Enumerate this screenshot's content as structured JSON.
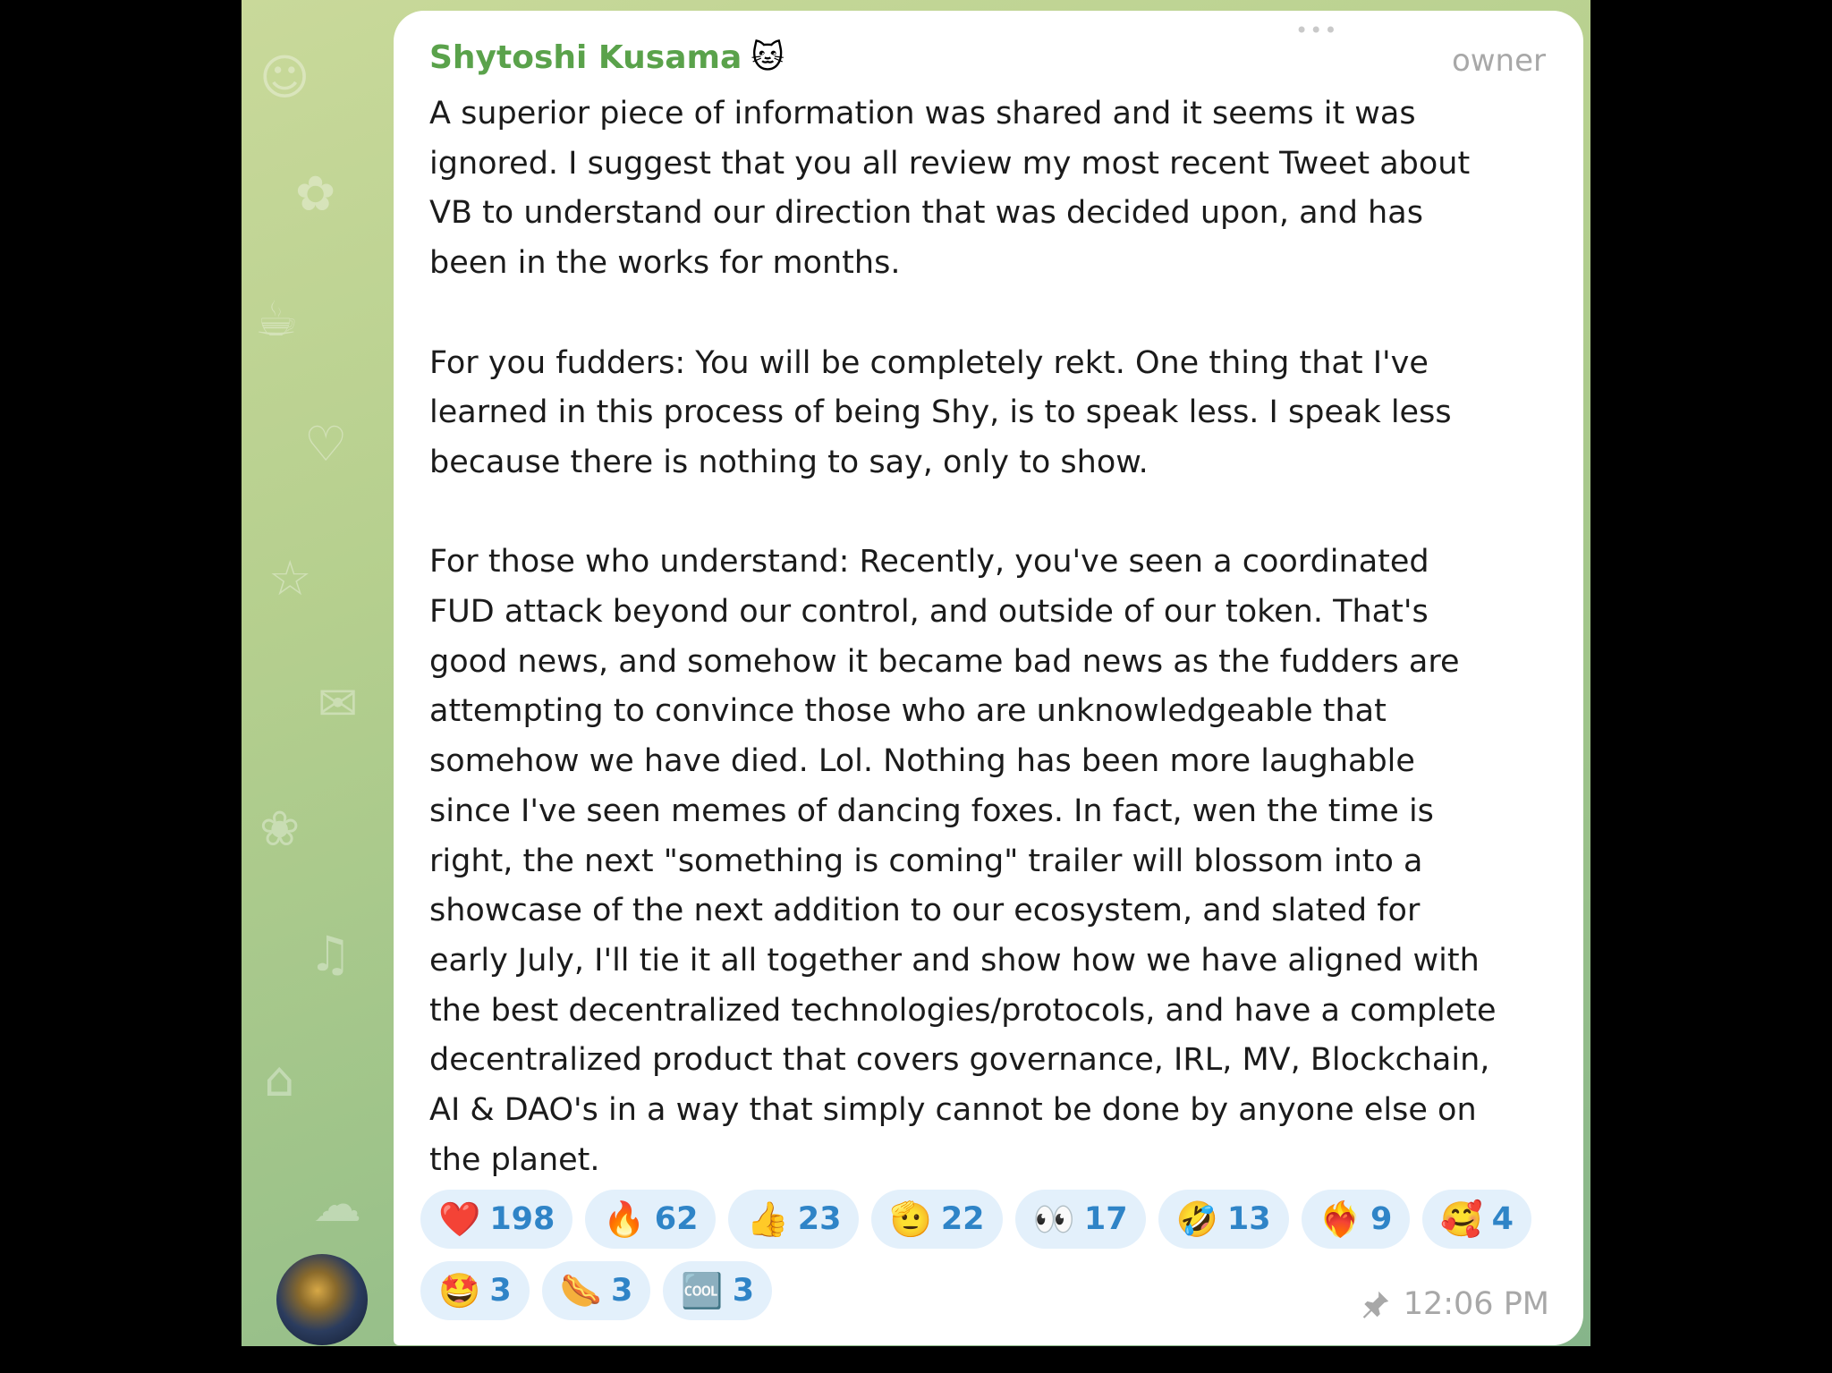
{
  "message": {
    "sender_name": "Shytoshi Kusama",
    "sender_emoji": "🐱",
    "role": "owner",
    "paragraphs": [
      "A superior piece of information was shared and it seems it was\nignored. I suggest that you all review my most recent Tweet about\nVB to understand our direction that was decided upon, and has\nbeen in the works for months.",
      "For you fudders: You will be completely rekt. One thing that I've\nlearned in this process of being Shy, is to speak less. I speak less\nbecause there is nothing to say, only to show.",
      "For those who understand: Recently, you've seen a coordinated\nFUD attack beyond our control, and outside of our token. That's\ngood news, and somehow it became bad news as the fudders are\nattempting to convince those who are unknowledgeable that\nsomehow we have died. Lol. Nothing has been more laughable\nsince I've seen memes of dancing foxes. In fact, wen the time is\nright, the next \"something is coming\" trailer will blossom into a\nshowcase of the next addition to our ecosystem, and slated for\nearly July, I'll tie it all together and show how we have aligned with\nthe best decentralized technologies/protocols, and have a complete\ndecentralized product that covers governance, IRL, MV, Blockchain,\nAI & DAO's in a way that simply cannot be done by anyone else on\nthe planet."
    ],
    "time": "12:06 PM"
  },
  "reactions": [
    {
      "icon": "red-heart-icon",
      "emoji": "❤️",
      "count": "198"
    },
    {
      "icon": "fire-icon",
      "emoji": "🔥",
      "count": "62"
    },
    {
      "icon": "thumbs-up-icon",
      "emoji": "👍",
      "count": "23"
    },
    {
      "icon": "salute-hand-icon",
      "emoji": "🫡",
      "count": "22"
    },
    {
      "icon": "eyes-icon",
      "emoji": "👀",
      "count": "17"
    },
    {
      "icon": "rofl-icon",
      "emoji": "🤣",
      "count": "13"
    },
    {
      "icon": "heart-on-fire-icon",
      "emoji": "❤️‍🔥",
      "count": "9"
    },
    {
      "icon": "smiling-hearts-icon",
      "emoji": "🥰",
      "count": "4"
    },
    {
      "icon": "star-struck-icon",
      "emoji": "🤩",
      "count": "3"
    },
    {
      "icon": "hot-dog-icon",
      "emoji": "🌭",
      "count": "3"
    },
    {
      "icon": "cool-icon",
      "emoji": "🆒",
      "count": "3"
    }
  ],
  "colors": {
    "sender_name": "#5aa24b",
    "reaction_text": "#2f84c7",
    "reaction_bg": "#e3f0fb",
    "meta_gray": "#a8a8a8"
  }
}
